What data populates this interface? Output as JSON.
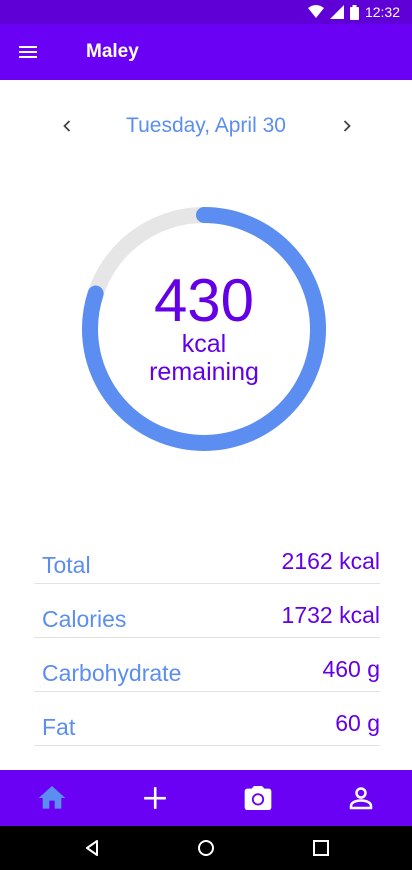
{
  "status_bar": {
    "time": "12:32",
    "icons": [
      "wifi-icon",
      "signal-icon",
      "battery-icon"
    ]
  },
  "app_bar": {
    "title": "Maley",
    "menu_icon": "hamburger-menu-icon"
  },
  "date_nav": {
    "label": "Tuesday, April 30",
    "prev_icon": "chevron-left-icon",
    "next_icon": "chevron-right-icon"
  },
  "summary": {
    "value": "430",
    "unit": "kcal",
    "label": "remaining",
    "progress_fraction": 0.8
  },
  "stats": [
    {
      "name": "Total",
      "value": "2162 kcal"
    },
    {
      "name": "Calories",
      "value": "1732 kcal"
    },
    {
      "name": "Carbohydrate",
      "value": "460 g"
    },
    {
      "name": "Fat",
      "value": "60 g"
    }
  ],
  "bottom_nav": [
    {
      "id": "home",
      "icon": "home-icon",
      "active": true
    },
    {
      "id": "add",
      "icon": "plus-icon",
      "active": false
    },
    {
      "id": "camera",
      "icon": "camera-icon",
      "active": false
    },
    {
      "id": "profile",
      "icon": "person-icon",
      "active": false
    }
  ],
  "colors": {
    "primary": "#6a00f4",
    "accent": "#5b8ef0",
    "text_value": "#6400e6",
    "ring_track": "#e6e6e6"
  }
}
